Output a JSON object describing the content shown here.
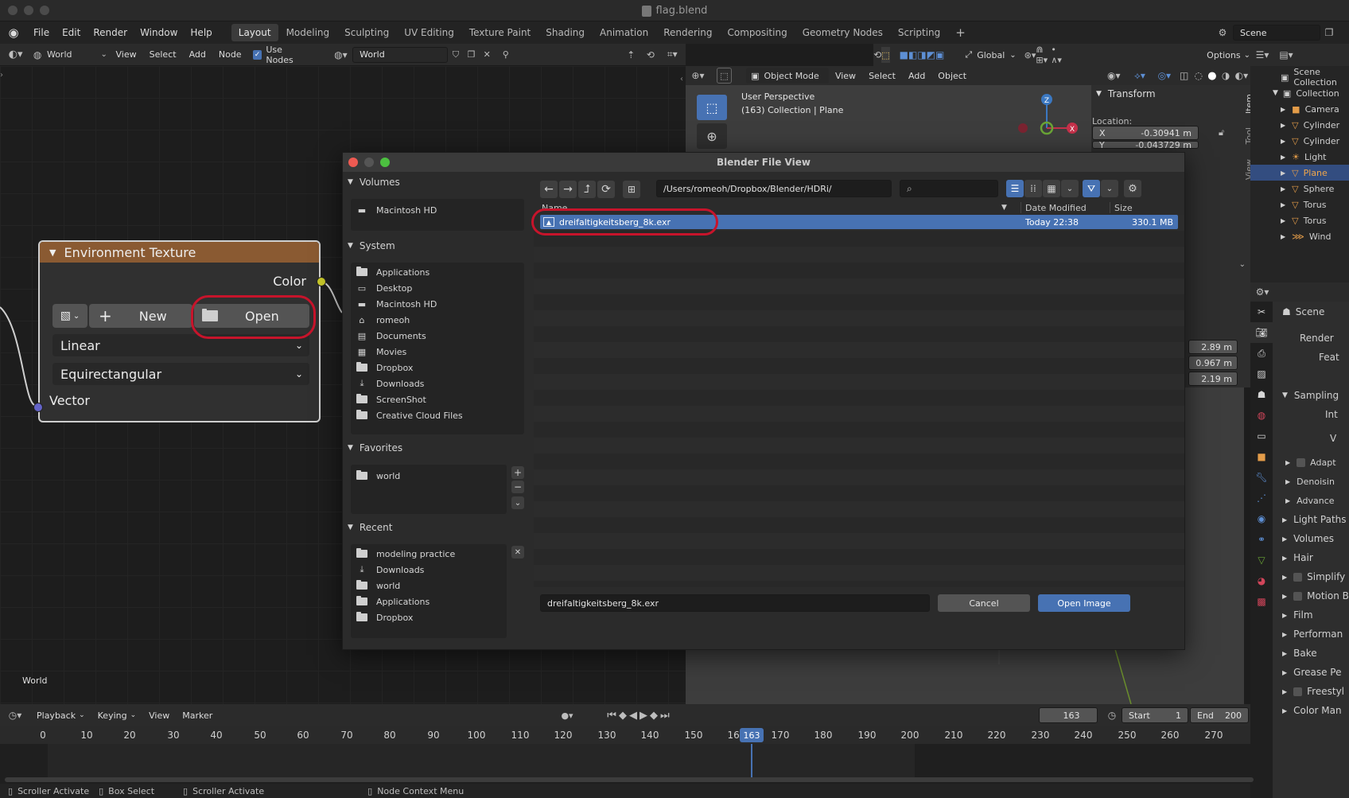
{
  "window": {
    "title": "flag.blend"
  },
  "menubar": {
    "items": [
      "File",
      "Edit",
      "Render",
      "Window",
      "Help"
    ],
    "workspaces": [
      "Layout",
      "Modeling",
      "Sculpting",
      "UV Editing",
      "Texture Paint",
      "Shading",
      "Animation",
      "Rendering",
      "Compositing",
      "Geometry Nodes",
      "Scripting"
    ],
    "active_workspace": "Layout",
    "scene": "Scene"
  },
  "node_header": {
    "type_value": "World",
    "menus": [
      "View",
      "Select",
      "Add",
      "Node"
    ],
    "use_nodes_label": "Use Nodes",
    "world_value": "World"
  },
  "env_node": {
    "title": "Environment Texture",
    "color_socket": "Color",
    "new_label": "New",
    "open_label": "Open",
    "interpolation": "Linear",
    "projection": "Equirectangular",
    "vector_socket": "Vector"
  },
  "node_editor": {
    "context_label": "World"
  },
  "viewport_header": {
    "mode": "Object Mode",
    "menus": [
      "View",
      "Select",
      "Add",
      "Object"
    ],
    "orientation": "Global",
    "options_label": "Options"
  },
  "viewport": {
    "perspective": "User Perspective",
    "collection_info": "(163) Collection | Plane",
    "axis_x": "X",
    "axis_z": "Z"
  },
  "npanel": {
    "section": "Transform",
    "location_label": "Location:",
    "x_label": "X",
    "x_value": "-0.30941 m",
    "y_label": "Y",
    "y_value": "-0.043729 m",
    "dims": [
      "2.89 m",
      "0.967 m",
      "2.19 m"
    ],
    "tabs": [
      "Item",
      "Tool",
      "View"
    ]
  },
  "outliner": {
    "root": "Scene Collection",
    "collection": "Collection",
    "items": [
      "Camera",
      "Cylinder",
      "Cylinder",
      "Light",
      "Plane",
      "Sphere",
      "Torus",
      "Torus",
      "Wind"
    ]
  },
  "properties": {
    "scene_label": "Scene",
    "render_label": "Render",
    "feature_label": "Feat",
    "sections": [
      "Sampling",
      "Adapt",
      "Denoisin",
      "Advance",
      "Light Paths",
      "Volumes",
      "Hair",
      "Simplify",
      "Motion B",
      "Film",
      "Performan",
      "Bake",
      "Grease Pe",
      "Freestyl",
      "Color Man"
    ],
    "int_label": "Int",
    "v_label": "V"
  },
  "dialog": {
    "title": "Blender File View",
    "path": "/Users/romeoh/Dropbox/Blender/HDRi/",
    "search_placeholder": "",
    "col_name": "Name",
    "col_date": "Date Modified",
    "col_size": "Size",
    "file": {
      "name": "dreifaltigkeitsberg_8k.exr",
      "date": "Today 22:38",
      "size": "330.1 MB"
    },
    "filename_value": "dreifaltigkeitsberg_8k.exr",
    "cancel_label": "Cancel",
    "open_label": "Open Image",
    "volumes": {
      "title": "Volumes",
      "items": [
        "Macintosh HD"
      ]
    },
    "system": {
      "title": "System",
      "items": [
        "Applications",
        "Desktop",
        "Macintosh HD",
        "romeoh",
        "Documents",
        "Movies",
        "Dropbox",
        "Downloads",
        "ScreenShot",
        "Creative Cloud Files"
      ]
    },
    "favorites": {
      "title": "Favorites",
      "items": [
        "world"
      ]
    },
    "recent": {
      "title": "Recent",
      "items": [
        "modeling practice",
        "Downloads",
        "world",
        "Applications",
        "Dropbox"
      ]
    }
  },
  "timeline": {
    "menus": [
      "Playback",
      "Keying",
      "View",
      "Marker"
    ],
    "current_frame": "163",
    "start_label": "Start",
    "start_value": "1",
    "end_label": "End",
    "end_value": "200",
    "ticks": [
      "0",
      "10",
      "20",
      "30",
      "40",
      "50",
      "60",
      "70",
      "80",
      "90",
      "100",
      "110",
      "120",
      "130",
      "140",
      "150",
      "160",
      "170",
      "180",
      "190",
      "200",
      "210",
      "220",
      "230",
      "240",
      "250",
      "260",
      "270"
    ]
  },
  "statusbar": {
    "items": [
      "Scroller Activate",
      "Box Select",
      "Scroller Activate",
      "Node Context Menu"
    ]
  }
}
